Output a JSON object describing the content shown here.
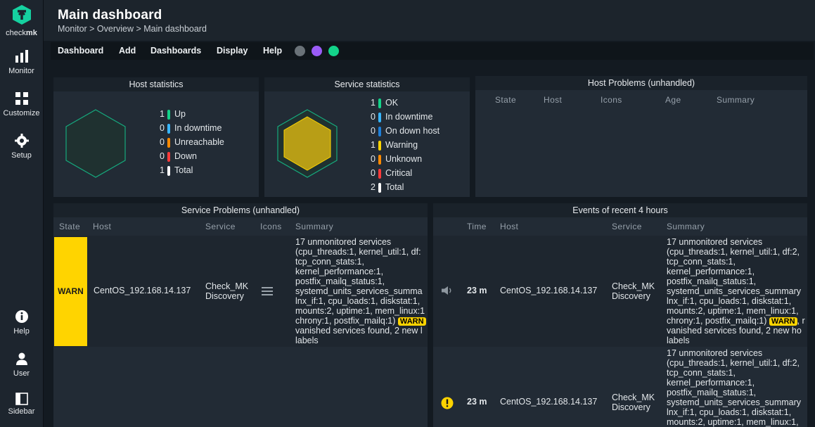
{
  "sidebar": {
    "logo_text_a": "check",
    "logo_text_b": "mk",
    "items": [
      {
        "label": "Monitor"
      },
      {
        "label": "Customize"
      },
      {
        "label": "Setup"
      },
      {
        "label": "Help"
      },
      {
        "label": "User"
      },
      {
        "label": "Sidebar"
      }
    ]
  },
  "header": {
    "title": "Main dashboard",
    "breadcrumb": "Monitor > Overview > Main dashboard"
  },
  "menu": {
    "items": [
      "Dashboard",
      "Add",
      "Dashboards",
      "Display",
      "Help"
    ],
    "icons": [
      "globe-icon",
      "checkmk-logo-icon",
      "list-icon"
    ]
  },
  "colors": {
    "ok": "#13d389",
    "downtime": "#38b6ff",
    "unreachable": "#ff8a00",
    "down": "#ff3a3a",
    "warn": "#ffd400",
    "on_down_host": "#1e7fd8",
    "unknown": "#ff8a00",
    "critical": "#ff3a3a",
    "total": "#ffffff"
  },
  "host_stats": {
    "title": "Host statistics",
    "rows": [
      {
        "count": "1",
        "label": "Up"
      },
      {
        "count": "0",
        "label": "In downtime"
      },
      {
        "count": "0",
        "label": "Unreachable"
      },
      {
        "count": "0",
        "label": "Down"
      },
      {
        "count": "1",
        "label": "Total"
      }
    ]
  },
  "service_stats": {
    "title": "Service statistics",
    "rows": [
      {
        "count": "1",
        "label": "OK"
      },
      {
        "count": "0",
        "label": "In downtime"
      },
      {
        "count": "0",
        "label": "On down host"
      },
      {
        "count": "1",
        "label": "Warning"
      },
      {
        "count": "0",
        "label": "Unknown"
      },
      {
        "count": "0",
        "label": "Critical"
      },
      {
        "count": "2",
        "label": "Total"
      }
    ]
  },
  "host_problems": {
    "title": "Host Problems (unhandled)",
    "columns": [
      "State",
      "Host",
      "Icons",
      "Age",
      "Summary"
    ]
  },
  "service_problems": {
    "title": "Service Problems (unhandled)",
    "columns": [
      "State",
      "Host",
      "Service",
      "Icons",
      "Summary"
    ],
    "rows": [
      {
        "state": "WARN",
        "host": "CentOS_192.168.14.137",
        "service_line1": "Check_MK",
        "service_line2": "Discovery",
        "summary_lines": [
          "17 unmonitored services",
          "(cpu_threads:1, kernel_util:1, df:",
          "tcp_conn_stats:1,",
          "kernel_performance:1,",
          "postfix_mailq_status:1,",
          "systemd_units_services_summa",
          "lnx_if:1, cpu_loads:1, diskstat:1,",
          "mounts:2, uptime:1, mem_linux:1",
          "chrony:1, postfix_mailq:1)",
          "vanished services found, 2 new l",
          "labels"
        ],
        "badge": "WARN"
      }
    ]
  },
  "events": {
    "title": "Events of recent 4 hours",
    "columns": [
      "Time",
      "Host",
      "Service",
      "Summary"
    ],
    "rows": [
      {
        "time": "23 m",
        "host": "CentOS_192.168.14.137",
        "service_line1": "Check_MK",
        "service_line2": "Discovery",
        "icon": "sound-icon",
        "summary_lines": [
          "17 unmonitored services",
          "(cpu_threads:1, kernel_util:1, df:2,",
          "tcp_conn_stats:1,",
          "kernel_performance:1,",
          "postfix_mailq_status:1,",
          "systemd_units_services_summary",
          "lnx_if:1, cpu_loads:1, diskstat:1,",
          "mounts:2, uptime:1, mem_linux:1,",
          "chrony:1, postfix_mailq:1)",
          "vanished services found, 2 new ho",
          "labels"
        ],
        "badge": "WARN",
        "badge_tail": ", r"
      },
      {
        "time": "23 m",
        "host": "CentOS_192.168.14.137",
        "service_line1": "Check_MK",
        "service_line2": "Discovery",
        "icon": "warning-icon",
        "summary_lines": [
          "17 unmonitored services",
          "(cpu_threads:1, kernel_util:1, df:2,",
          "tcp_conn_stats:1,",
          "kernel_performance:1,",
          "postfix_mailq_status:1,",
          "systemd_units_services_summary",
          "lnx_if:1, cpu_loads:1, diskstat:1,",
          "mounts:2, uptime:1, mem_linux:1,"
        ]
      }
    ]
  }
}
